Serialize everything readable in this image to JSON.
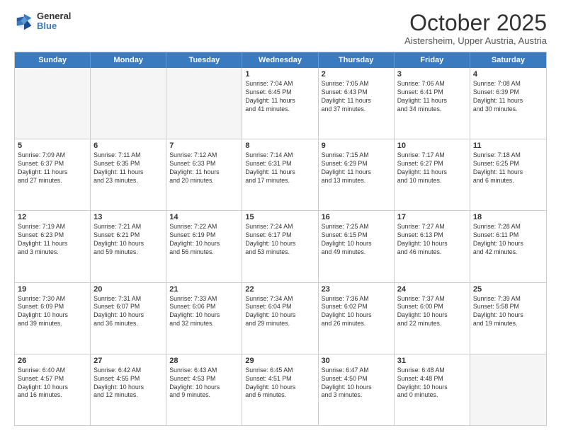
{
  "header": {
    "logo": {
      "general": "General",
      "blue": "Blue"
    },
    "title": "October 2025",
    "location": "Aistersheim, Upper Austria, Austria"
  },
  "days_of_week": [
    "Sunday",
    "Monday",
    "Tuesday",
    "Wednesday",
    "Thursday",
    "Friday",
    "Saturday"
  ],
  "weeks": [
    [
      {
        "day": "",
        "info": "",
        "empty": true
      },
      {
        "day": "",
        "info": "",
        "empty": true
      },
      {
        "day": "",
        "info": "",
        "empty": true
      },
      {
        "day": "1",
        "info": "Sunrise: 7:04 AM\nSunset: 6:45 PM\nDaylight: 11 hours\nand 41 minutes."
      },
      {
        "day": "2",
        "info": "Sunrise: 7:05 AM\nSunset: 6:43 PM\nDaylight: 11 hours\nand 37 minutes."
      },
      {
        "day": "3",
        "info": "Sunrise: 7:06 AM\nSunset: 6:41 PM\nDaylight: 11 hours\nand 34 minutes."
      },
      {
        "day": "4",
        "info": "Sunrise: 7:08 AM\nSunset: 6:39 PM\nDaylight: 11 hours\nand 30 minutes."
      }
    ],
    [
      {
        "day": "5",
        "info": "Sunrise: 7:09 AM\nSunset: 6:37 PM\nDaylight: 11 hours\nand 27 minutes."
      },
      {
        "day": "6",
        "info": "Sunrise: 7:11 AM\nSunset: 6:35 PM\nDaylight: 11 hours\nand 23 minutes."
      },
      {
        "day": "7",
        "info": "Sunrise: 7:12 AM\nSunset: 6:33 PM\nDaylight: 11 hours\nand 20 minutes."
      },
      {
        "day": "8",
        "info": "Sunrise: 7:14 AM\nSunset: 6:31 PM\nDaylight: 11 hours\nand 17 minutes."
      },
      {
        "day": "9",
        "info": "Sunrise: 7:15 AM\nSunset: 6:29 PM\nDaylight: 11 hours\nand 13 minutes."
      },
      {
        "day": "10",
        "info": "Sunrise: 7:17 AM\nSunset: 6:27 PM\nDaylight: 11 hours\nand 10 minutes."
      },
      {
        "day": "11",
        "info": "Sunrise: 7:18 AM\nSunset: 6:25 PM\nDaylight: 11 hours\nand 6 minutes."
      }
    ],
    [
      {
        "day": "12",
        "info": "Sunrise: 7:19 AM\nSunset: 6:23 PM\nDaylight: 11 hours\nand 3 minutes."
      },
      {
        "day": "13",
        "info": "Sunrise: 7:21 AM\nSunset: 6:21 PM\nDaylight: 10 hours\nand 59 minutes."
      },
      {
        "day": "14",
        "info": "Sunrise: 7:22 AM\nSunset: 6:19 PM\nDaylight: 10 hours\nand 56 minutes."
      },
      {
        "day": "15",
        "info": "Sunrise: 7:24 AM\nSunset: 6:17 PM\nDaylight: 10 hours\nand 53 minutes."
      },
      {
        "day": "16",
        "info": "Sunrise: 7:25 AM\nSunset: 6:15 PM\nDaylight: 10 hours\nand 49 minutes."
      },
      {
        "day": "17",
        "info": "Sunrise: 7:27 AM\nSunset: 6:13 PM\nDaylight: 10 hours\nand 46 minutes."
      },
      {
        "day": "18",
        "info": "Sunrise: 7:28 AM\nSunset: 6:11 PM\nDaylight: 10 hours\nand 42 minutes."
      }
    ],
    [
      {
        "day": "19",
        "info": "Sunrise: 7:30 AM\nSunset: 6:09 PM\nDaylight: 10 hours\nand 39 minutes."
      },
      {
        "day": "20",
        "info": "Sunrise: 7:31 AM\nSunset: 6:07 PM\nDaylight: 10 hours\nand 36 minutes."
      },
      {
        "day": "21",
        "info": "Sunrise: 7:33 AM\nSunset: 6:06 PM\nDaylight: 10 hours\nand 32 minutes."
      },
      {
        "day": "22",
        "info": "Sunrise: 7:34 AM\nSunset: 6:04 PM\nDaylight: 10 hours\nand 29 minutes."
      },
      {
        "day": "23",
        "info": "Sunrise: 7:36 AM\nSunset: 6:02 PM\nDaylight: 10 hours\nand 26 minutes."
      },
      {
        "day": "24",
        "info": "Sunrise: 7:37 AM\nSunset: 6:00 PM\nDaylight: 10 hours\nand 22 minutes."
      },
      {
        "day": "25",
        "info": "Sunrise: 7:39 AM\nSunset: 5:58 PM\nDaylight: 10 hours\nand 19 minutes."
      }
    ],
    [
      {
        "day": "26",
        "info": "Sunrise: 6:40 AM\nSunset: 4:57 PM\nDaylight: 10 hours\nand 16 minutes."
      },
      {
        "day": "27",
        "info": "Sunrise: 6:42 AM\nSunset: 4:55 PM\nDaylight: 10 hours\nand 12 minutes."
      },
      {
        "day": "28",
        "info": "Sunrise: 6:43 AM\nSunset: 4:53 PM\nDaylight: 10 hours\nand 9 minutes."
      },
      {
        "day": "29",
        "info": "Sunrise: 6:45 AM\nSunset: 4:51 PM\nDaylight: 10 hours\nand 6 minutes."
      },
      {
        "day": "30",
        "info": "Sunrise: 6:47 AM\nSunset: 4:50 PM\nDaylight: 10 hours\nand 3 minutes."
      },
      {
        "day": "31",
        "info": "Sunrise: 6:48 AM\nSunset: 4:48 PM\nDaylight: 10 hours\nand 0 minutes."
      },
      {
        "day": "",
        "info": "",
        "empty": true
      }
    ]
  ]
}
